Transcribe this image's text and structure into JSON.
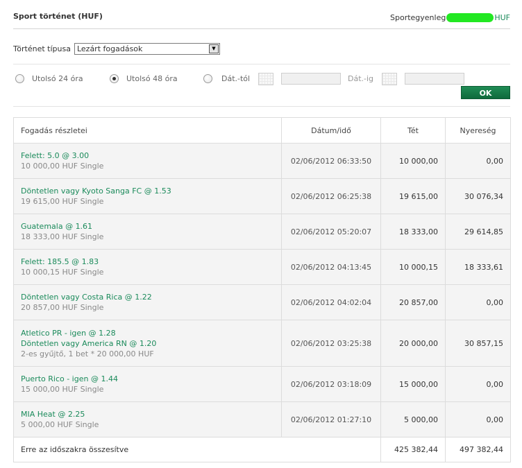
{
  "header": {
    "title": "Sport történet (HUF)",
    "balance_label": "Sportegyenleg",
    "balance_currency": "HUF"
  },
  "filters": {
    "type_label": "Történet típusa",
    "type_selected": "Lezárt fogadások",
    "radio_24": "Utolsó 24 óra",
    "radio_48": "Utolsó 48 óra",
    "from_label": "Dát.-tól",
    "to_label": "Dát.-ig",
    "selected_period": "48h",
    "ok_label": "OK"
  },
  "table": {
    "headers": {
      "details": "Fogadás részletei",
      "date": "Dátum/idő",
      "stake": "Tét",
      "winnings": "Nyereség"
    },
    "rows": [
      {
        "sel1": "Felett: 5.0 @ 3.00",
        "sel2": "",
        "sub": "10 000,00 HUF Single",
        "date": "02/06/2012 06:33:50",
        "stake": "10 000,00",
        "win": "0,00"
      },
      {
        "sel1": "Döntetlen vagy Kyoto Sanga FC @ 1.53",
        "sel2": "",
        "sub": "19 615,00 HUF Single",
        "date": "02/06/2012 06:25:38",
        "stake": "19 615,00",
        "win": "30 076,34"
      },
      {
        "sel1": "Guatemala @ 1.61",
        "sel2": "",
        "sub": "18 333,00 HUF Single",
        "date": "02/06/2012 05:20:07",
        "stake": "18 333,00",
        "win": "29 614,85"
      },
      {
        "sel1": "Felett: 185.5 @ 1.83",
        "sel2": "",
        "sub": "10 000,15 HUF Single",
        "date": "02/06/2012 04:13:45",
        "stake": "10 000,15",
        "win": "18 333,61"
      },
      {
        "sel1": "Döntetlen vagy Costa Rica @ 1.22",
        "sel2": "",
        "sub": "20 857,00 HUF Single",
        "date": "02/06/2012 04:02:04",
        "stake": "20 857,00",
        "win": "0,00"
      },
      {
        "sel1": "Atletico PR - igen @ 1.28",
        "sel2": "Döntetlen vagy America RN @ 1.20",
        "sub": "2-es gyűjtő, 1 bet * 20 000,00 HUF",
        "date": "02/06/2012 03:25:38",
        "stake": "20 000,00",
        "win": "30 857,15"
      },
      {
        "sel1": "Puerto Rico - igen @ 1.44",
        "sel2": "",
        "sub": "15 000,00 HUF Single",
        "date": "02/06/2012 03:18:09",
        "stake": "15 000,00",
        "win": "0,00"
      },
      {
        "sel1": "MIA Heat @ 2.25",
        "sel2": "",
        "sub": "5 000,00 HUF Single",
        "date": "02/06/2012 01:27:10",
        "stake": "5 000,00",
        "win": "0,00"
      }
    ],
    "total": {
      "label": "Erre az időszakra összesítve",
      "stake": "425 382,44",
      "win": "497 382,44"
    }
  },
  "colors": {
    "link_green": "#1a8a5a",
    "button_green": "#0f6a3c",
    "balance_mask": "#22e822"
  }
}
